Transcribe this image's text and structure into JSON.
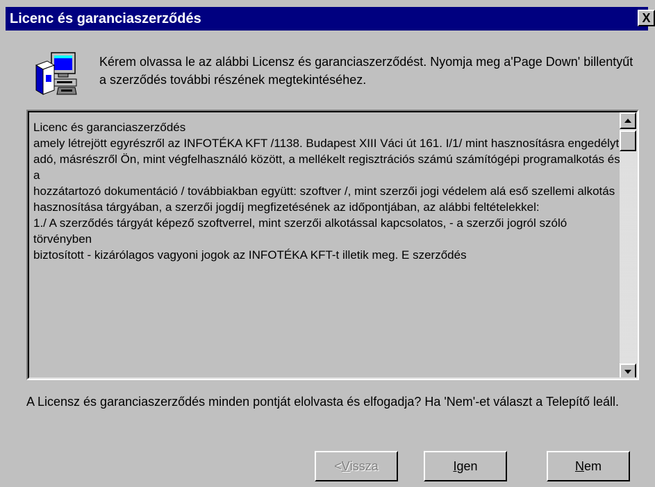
{
  "window": {
    "title": "Licenc és garanciaszerződés",
    "close_label": "X"
  },
  "icon": {
    "name": "setup-computer-icon"
  },
  "intro_text": "Kérem olvassa le az alábbi Licensz és garanciaszerződést. Nyomja meg a'Page Down' billentyűt a szerződés további részének megtekintéséhez.",
  "license": {
    "paragraphs": [
      "Licenc és garanciaszerződés",
      "",
      "amely létrejött egyrészről az INFOTÉKA KFT /1138. Budapest XIII Váci út 161. I/1/ mint hasznosításra engedélyt",
      "adó, másrészről Ön, mint végfelhasználó között, a mellékelt regisztrációs számú számítógépi programalkotás és a",
      "hozzátartozó dokumentáció / továbbiakban együtt: szoftver /, mint szerzői jogi védelem alá eső szellemi alkotás",
      "hasznosítása tárgyában, a szerzői jogdíj megfizetésének az időpontjában, az alábbi feltételekkel:",
      "",
      "1./ A szerződés tárgyát képező szoftverrel, mint szerzői alkotással kapcsolatos, - a szerzői jogról szóló törvényben",
      "biztosított - kizárólagos vagyoni jogok az INFOTÉKA KFT-t illetik meg. E szerződés"
    ]
  },
  "question_text": "A Licensz és garanciaszerződés minden pontját elolvasta és elfogadja? Ha 'Nem'-et választ a Telepítő leáll.",
  "buttons": {
    "back": {
      "prefix": "< ",
      "accel": "V",
      "rest": "issza"
    },
    "yes": {
      "accel": "I",
      "rest": "gen"
    },
    "no": {
      "accel": "N",
      "rest": "em"
    }
  },
  "colors": {
    "titlebar": "#000080",
    "face": "#c0c0c0"
  }
}
